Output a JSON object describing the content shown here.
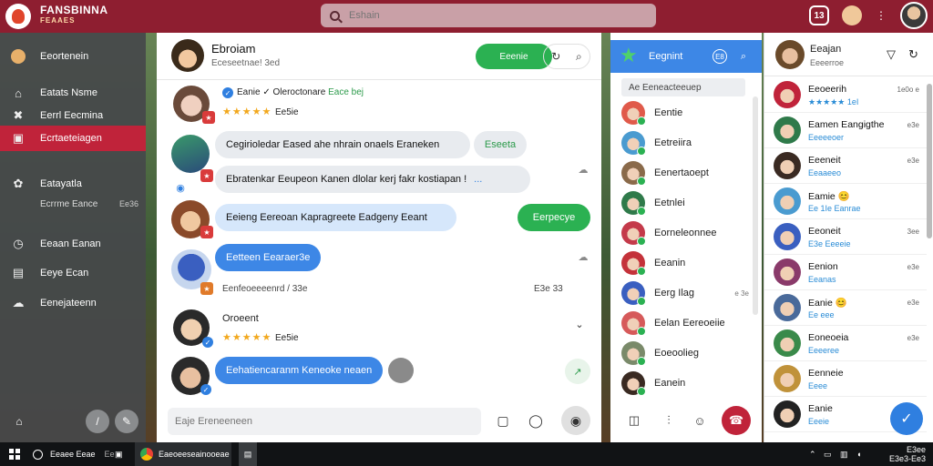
{
  "app": {
    "brand_line1": "FANSBINNA",
    "brand_line2": "FEAAES"
  },
  "search": {
    "placeholder": "Eshain"
  },
  "topbar": {
    "count_badge": "13"
  },
  "sidebar": {
    "items": [
      {
        "label": "Eeortenein",
        "icon": "avatar-icon"
      },
      {
        "label": "Eatats Nsme",
        "icon": "home-icon"
      },
      {
        "label": "Eerrl Eecmina",
        "icon": "cross-icon"
      },
      {
        "label": "Ecrtaeteiagen",
        "icon": "inbox-icon",
        "active": true
      },
      {
        "label": "Eatayatla",
        "icon": "gear-icon"
      },
      {
        "label": "Ecrrme Eance",
        "sub": true,
        "count": "Ee36"
      },
      {
        "label": "Eeaan Eanan",
        "icon": "clock-icon"
      },
      {
        "label": "Eeye Ecan",
        "icon": "image-icon"
      },
      {
        "label": "Eenejateenn",
        "icon": "cloud-icon"
      }
    ]
  },
  "chat": {
    "name": "Ebroiam",
    "status": "Eceseetnae! 3ed",
    "action_button": "Eeenie",
    "messages": [
      {
        "meta": "Eanie ✓ Oleroctonare",
        "meta_tag": "Eace bej",
        "stars": "★★★★★",
        "time": "Ee5ie"
      },
      {
        "bubble": "Cegirioledar Eased ahe nhrain onaels Eraneken",
        "side_label": "Eseeta"
      },
      {
        "bubble": "Ebratenkar Eeupeon Kanen dlolar kerj fakr kostiapan !",
        "ellipsis": "..."
      },
      {
        "bubble": "Eeieng Eereoan Kapragreete Eadgeny Eeant",
        "reply": "Eerpecye"
      },
      {
        "bubble": "Eetteen Eearaer3e"
      },
      {
        "meta": "Eenfeoeeeenrd / 33e",
        "time": "E3e 33"
      },
      {
        "meta": "Oroeent",
        "stars": "★★★★★",
        "time": "Ee5ie"
      },
      {
        "bubble": "Eehatiencaranm Keneoke neaen"
      }
    ],
    "composer_placeholder": "Eaje Ereneeneen"
  },
  "contacts": {
    "title": "Eegnint",
    "count": "E8",
    "search_label": "Ae Eeneacteeuep",
    "items": [
      {
        "name": "Eentie",
        "color": "#e05a4a"
      },
      {
        "name": "Eetreiira",
        "color": "#4a9bd0"
      },
      {
        "name": "Eenertaoept",
        "color": "#8a6a4a"
      },
      {
        "name": "Eetnlei",
        "color": "#2f7a4a"
      },
      {
        "name": "Eorneleonnee",
        "color": "#c43a4a"
      },
      {
        "name": "Eeanin",
        "color": "#c4323a"
      },
      {
        "name": "Eerg Ilag",
        "color": "#3a5fc0",
        "time": "e 3e"
      },
      {
        "name": "Eelan Eereoeiie",
        "color": "#d65a5a"
      },
      {
        "name": "Eoeoolieg",
        "color": "#7a8a6a"
      },
      {
        "name": "Eanein",
        "color": "#3a2a22"
      }
    ]
  },
  "chatlist": {
    "name": "Eeajan",
    "status": "Eeeerroe",
    "rows": [
      {
        "name": "Eeoeerih",
        "status": "★★★★★ 1eI",
        "time": "1e0o e",
        "color": "#c0233a"
      },
      {
        "name": "Eamen Eangigthe",
        "status": "Eeeeeoer",
        "time": "e3e",
        "color": "#2f7a4a"
      },
      {
        "name": "Eeeneit",
        "status": "Eeaaeeo",
        "time": "e3e",
        "color": "#3a2a22"
      },
      {
        "name": "Eamie 😊",
        "status": "Ee 1Ie Eanrae",
        "time": "",
        "color": "#4a9bd0"
      },
      {
        "name": "Eeoneit",
        "status": "E3e Eeeeie",
        "time": "3ee",
        "color": "#3a5fc0"
      },
      {
        "name": "Eenion",
        "status": "Eeanas",
        "time": "e3e",
        "color": "#8a3a6a"
      },
      {
        "name": "Eanie 😊",
        "status": "Ee eee",
        "time": "e3e",
        "color": "#4a6a9a"
      },
      {
        "name": "Eoneoeia",
        "status": "Eeeeree",
        "time": "e3e",
        "color": "#3a8a4a"
      },
      {
        "name": "Eenneie",
        "status": "Eeee",
        "time": "",
        "color": "#c0923a"
      },
      {
        "name": "Eanie",
        "status": "Eeeie",
        "time": "",
        "color": "#222222"
      }
    ]
  },
  "taskbar": {
    "search": "Eeaee Eeae",
    "search_count": "Ee",
    "active_app": "Eaeoeeseainooeae",
    "time": "E3ee",
    "date": "E3e3-Ee3"
  }
}
